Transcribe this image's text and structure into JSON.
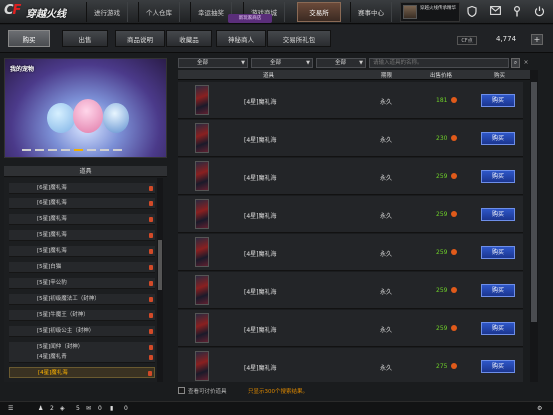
{
  "app": {
    "logo_text": "穿越火线",
    "nav": [
      {
        "label": "进行游戏"
      },
      {
        "label": "个人仓库"
      },
      {
        "label": "幸运抽奖"
      },
      {
        "label": "游戏商城"
      },
      {
        "label": "交易所"
      },
      {
        "label": "赛事中心"
      }
    ],
    "promo_badge": "新玩家商店",
    "user_box_text": "穿越火线传承精华",
    "top_icons": [
      "shield-icon",
      "mail-icon",
      "wrench-icon",
      "power-icon"
    ]
  },
  "tabs": [
    {
      "label": "购买"
    },
    {
      "label": "出售"
    },
    {
      "label": "商品说明"
    },
    {
      "label": "收藏品"
    },
    {
      "label": "神秘商人"
    },
    {
      "label": "交易所礼包"
    }
  ],
  "currency": {
    "badge": "CF点",
    "balance": "4,774",
    "plus": "+"
  },
  "banner": {
    "title": "我的宠物"
  },
  "item_list": {
    "header": "道具",
    "items": [
      {
        "label": "[6星]魔礼海"
      },
      {
        "label": "[6星]魔礼海"
      },
      {
        "label": "[5星]魔礼海"
      },
      {
        "label": "[5星]魔礼海"
      },
      {
        "label": "[5星]魔礼海"
      },
      {
        "label": "[5星]白猫"
      },
      {
        "label": "[5星]辛公豹"
      },
      {
        "label": "[5星]初级魔法工（封神）"
      },
      {
        "label": "[5星]牛魔王（封神）"
      },
      {
        "label": "[5星]初级公主（封神）"
      },
      {
        "label": "[5星]闻仲（封神）"
      },
      {
        "label": "[4星]魔礼青"
      },
      {
        "label": "[4星]魔礼海"
      }
    ]
  },
  "filters": {
    "dropdown1": "全部",
    "dropdown2": "全部",
    "dropdown3": "全部",
    "search_placeholder": "请输入道具的名称。"
  },
  "table": {
    "headers": {
      "item": "道具",
      "duration": "期限",
      "price": "出售价格",
      "buy": "购买"
    },
    "rows": [
      {
        "name": "[4星]魔礼海",
        "duration": "永久",
        "price": "181",
        "buy": "购买"
      },
      {
        "name": "[4星]魔礼海",
        "duration": "永久",
        "price": "230",
        "buy": "购买"
      },
      {
        "name": "[4星]魔礼海",
        "duration": "永久",
        "price": "259",
        "buy": "购买"
      },
      {
        "name": "[4星]魔礼海",
        "duration": "永久",
        "price": "259",
        "buy": "购买"
      },
      {
        "name": "[4星]魔礼海",
        "duration": "永久",
        "price": "259",
        "buy": "购买"
      },
      {
        "name": "[4星]魔礼海",
        "duration": "永久",
        "price": "259",
        "buy": "购买"
      },
      {
        "name": "[4星]魔礼海",
        "duration": "永久",
        "price": "259",
        "buy": "购买"
      },
      {
        "name": "[4星]魔礼海",
        "duration": "永久",
        "price": "275",
        "buy": "购买"
      }
    ]
  },
  "footer": {
    "checkbox_label": "查看可讨价道具",
    "result_note": "只显示300个搜索结果。"
  },
  "status_bar": {
    "friends": "2",
    "clan": "5",
    "chat": "0",
    "messages": "0"
  }
}
